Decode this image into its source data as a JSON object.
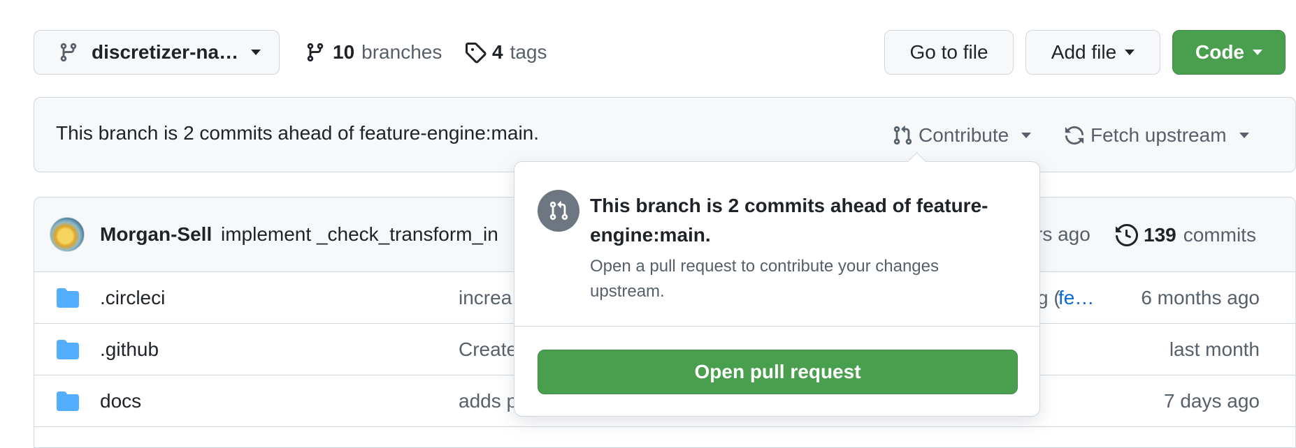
{
  "toolbar": {
    "branch_label": "discretizer-na…",
    "branches_count": "10",
    "branches_label": "branches",
    "tags_count": "4",
    "tags_label": "tags",
    "go_to_file": "Go to file",
    "add_file": "Add file",
    "code": "Code"
  },
  "banner": {
    "status": "This branch is 2 commits ahead of feature-engine:main.",
    "contribute": "Contribute",
    "fetch_upstream": "Fetch upstream"
  },
  "commit_bar": {
    "author": "Morgan-Sell",
    "message": "implement _check_transform_in",
    "time_fragment": "rs ago",
    "commits_count": "139",
    "commits_label": "commits"
  },
  "files": [
    {
      "name": ".circleci",
      "message": "increa",
      "msg_tail": "g (",
      "link_tail": "fe…",
      "age": "6 months ago"
    },
    {
      "name": ".github",
      "message": "Create",
      "msg_tail": "",
      "link_tail": "",
      "age": "last month"
    },
    {
      "name": "docs",
      "message": "adds p",
      "msg_tail": "",
      "link_tail": "",
      "age": "7 days ago"
    }
  ],
  "popover": {
    "title": "This branch is 2 commits ahead of feature-engine:main.",
    "description": "Open a pull request to contribute your changes upstream.",
    "button": "Open pull request"
  },
  "colors": {
    "primary_green": "#4a9f4f",
    "link_blue": "#0969da",
    "folder_blue": "#54aeff",
    "border": "#d0d7de"
  }
}
